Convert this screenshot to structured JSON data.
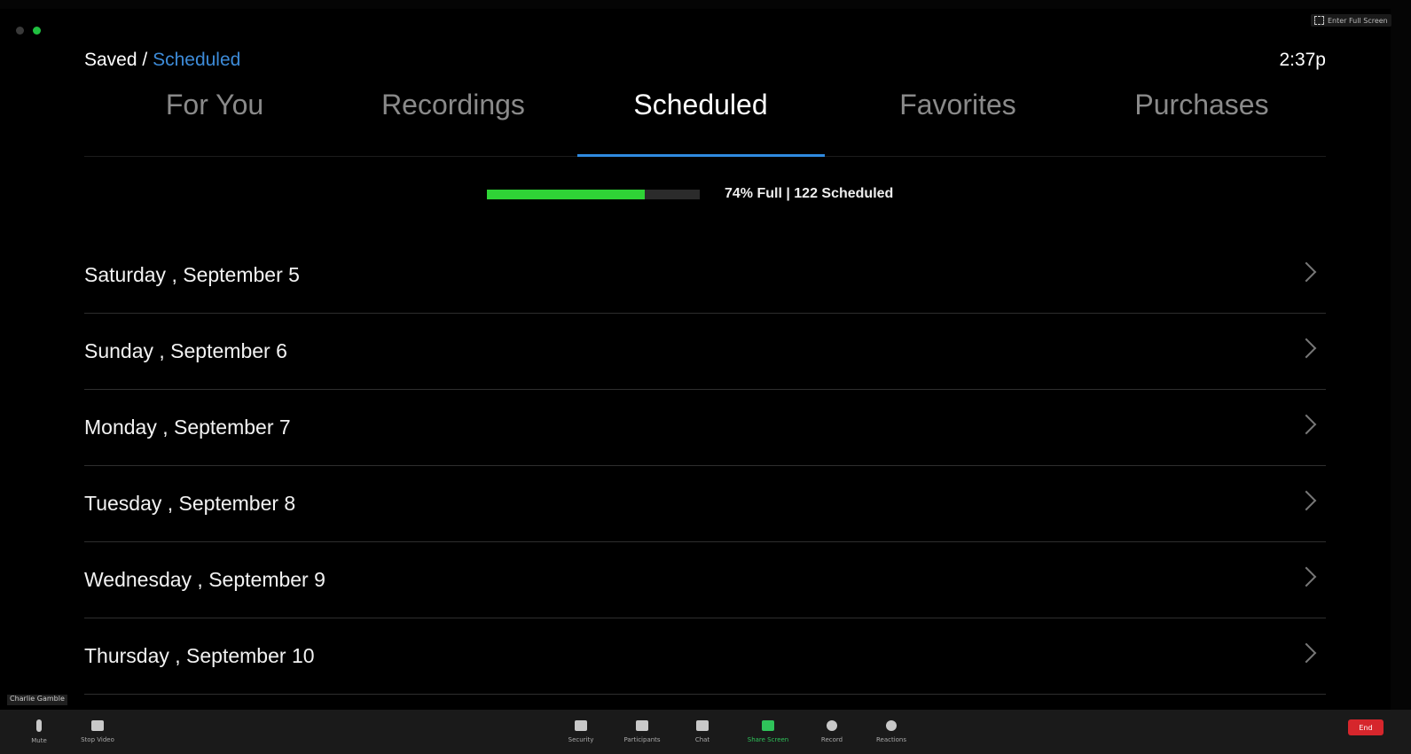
{
  "window": {
    "fullscreen_label": "Enter Full Screen"
  },
  "header": {
    "breadcrumb_parent": "Saved",
    "breadcrumb_separator": "/",
    "breadcrumb_current": "Scheduled",
    "clock": "2:37p"
  },
  "tabs": [
    {
      "label": "For You",
      "active": false
    },
    {
      "label": "Recordings",
      "active": false
    },
    {
      "label": "Scheduled",
      "active": true
    },
    {
      "label": "Favorites",
      "active": false
    },
    {
      "label": "Purchases",
      "active": false
    }
  ],
  "storage": {
    "fill_percent": 74,
    "text": "74% Full |  122 Scheduled"
  },
  "days": [
    "Saturday , September 5",
    "Sunday , September 6",
    "Monday , September 7",
    "Tuesday , September 8",
    "Wednesday , September 9",
    "Thursday , September 10"
  ],
  "zoom_toolbar": {
    "participant_name": "Charlie Gamble",
    "buttons": [
      {
        "id": "mute",
        "label": "Mute",
        "icon": "microphone-icon"
      },
      {
        "id": "stop-video",
        "label": "Stop Video",
        "icon": "video-camera-icon"
      },
      {
        "id": "security",
        "label": "Security",
        "icon": "shield-icon"
      },
      {
        "id": "participants",
        "label": "Participants",
        "icon": "participants-icon"
      },
      {
        "id": "chat",
        "label": "Chat",
        "icon": "chat-icon"
      },
      {
        "id": "share-screen",
        "label": "Share Screen",
        "icon": "share-screen-icon"
      },
      {
        "id": "record",
        "label": "Record",
        "icon": "record-icon"
      },
      {
        "id": "reactions",
        "label": "Reactions",
        "icon": "reactions-icon"
      }
    ],
    "end_label": "End"
  },
  "colors": {
    "accent": "#2f8ae0",
    "breadcrumb_current": "#3d8bd8",
    "storage_fill": "#2fd336",
    "end_button": "#d6262c",
    "share_screen": "#2fc35a"
  }
}
